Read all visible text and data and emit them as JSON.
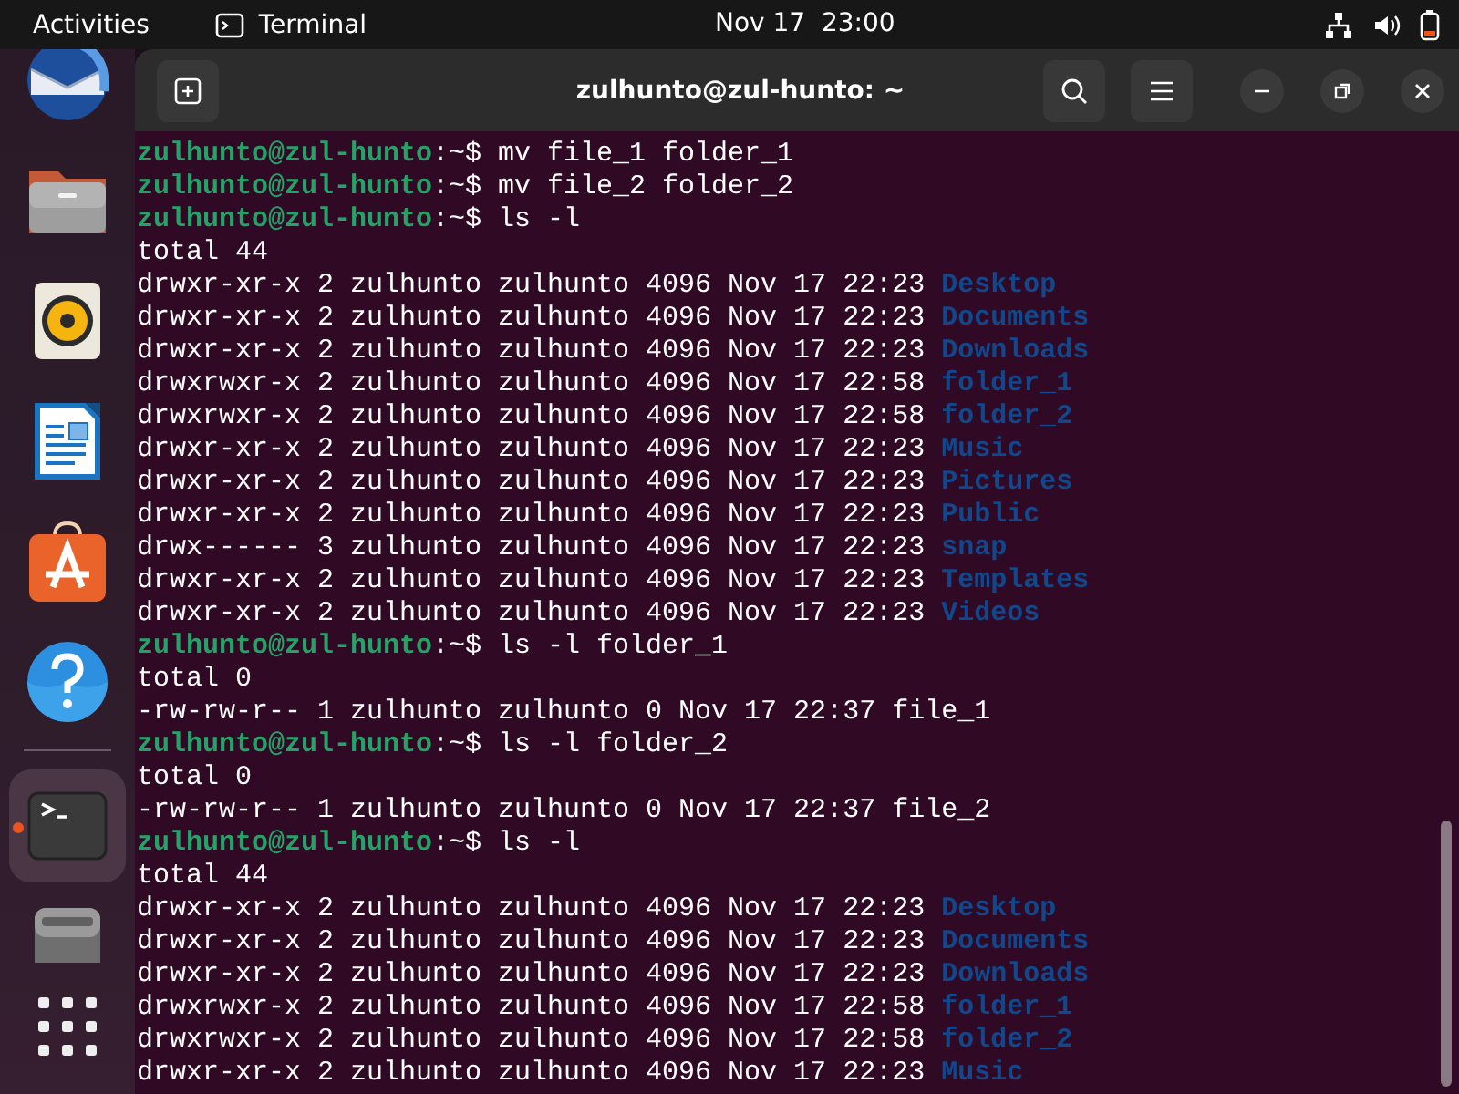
{
  "top_bar": {
    "activities": "Activities",
    "app_name": "Terminal",
    "clock": "Nov 17  23:00"
  },
  "dock": [
    {
      "kind": "mail",
      "focused": false,
      "running": false
    },
    {
      "kind": "files",
      "focused": false,
      "running": false
    },
    {
      "kind": "music",
      "focused": false,
      "running": false
    },
    {
      "kind": "writer",
      "focused": false,
      "running": false
    },
    {
      "kind": "store",
      "focused": false,
      "running": false
    },
    {
      "kind": "help",
      "focused": false,
      "running": false
    },
    {
      "kind": "separator"
    },
    {
      "kind": "terminal",
      "focused": true,
      "running": true
    },
    {
      "kind": "disk",
      "focused": false,
      "running": false
    },
    {
      "kind": "apps"
    }
  ],
  "window": {
    "title": "zulhunto@zul-hunto: ~"
  },
  "terminal": {
    "lines": [
      {
        "kind": "prompt",
        "user": "zulhunto@zul-hunto",
        "rest": ":~$ mv file_1 folder_1"
      },
      {
        "kind": "prompt",
        "user": "zulhunto@zul-hunto",
        "rest": ":~$ mv file_2 folder_2"
      },
      {
        "kind": "prompt",
        "user": "zulhunto@zul-hunto",
        "rest": ":~$ ls -l"
      },
      {
        "kind": "output",
        "text": "total 44"
      },
      {
        "kind": "entry",
        "info": "drwxr-xr-x 2 zulhunto zulhunto 4096 Nov 17 22:23",
        "name": "Desktop",
        "directory": true
      },
      {
        "kind": "entry",
        "info": "drwxr-xr-x 2 zulhunto zulhunto 4096 Nov 17 22:23",
        "name": "Documents",
        "directory": true
      },
      {
        "kind": "entry",
        "info": "drwxr-xr-x 2 zulhunto zulhunto 4096 Nov 17 22:23",
        "name": "Downloads",
        "directory": true
      },
      {
        "kind": "entry",
        "info": "drwxrwxr-x 2 zulhunto zulhunto 4096 Nov 17 22:58",
        "name": "folder_1",
        "directory": true
      },
      {
        "kind": "entry",
        "info": "drwxrwxr-x 2 zulhunto zulhunto 4096 Nov 17 22:58",
        "name": "folder_2",
        "directory": true
      },
      {
        "kind": "entry",
        "info": "drwxr-xr-x 2 zulhunto zulhunto 4096 Nov 17 22:23",
        "name": "Music",
        "directory": true
      },
      {
        "kind": "entry",
        "info": "drwxr-xr-x 2 zulhunto zulhunto 4096 Nov 17 22:23",
        "name": "Pictures",
        "directory": true
      },
      {
        "kind": "entry",
        "info": "drwxr-xr-x 2 zulhunto zulhunto 4096 Nov 17 22:23",
        "name": "Public",
        "directory": true
      },
      {
        "kind": "entry",
        "info": "drwx------ 3 zulhunto zulhunto 4096 Nov 17 22:23",
        "name": "snap",
        "directory": true
      },
      {
        "kind": "entry",
        "info": "drwxr-xr-x 2 zulhunto zulhunto 4096 Nov 17 22:23",
        "name": "Templates",
        "directory": true
      },
      {
        "kind": "entry",
        "info": "drwxr-xr-x 2 zulhunto zulhunto 4096 Nov 17 22:23",
        "name": "Videos",
        "directory": true
      },
      {
        "kind": "prompt",
        "user": "zulhunto@zul-hunto",
        "rest": ":~$ ls -l folder_1"
      },
      {
        "kind": "output",
        "text": "total 0"
      },
      {
        "kind": "entry",
        "info": "-rw-rw-r-- 1 zulhunto zulhunto 0 Nov 17 22:37",
        "name": "file_1",
        "directory": false
      },
      {
        "kind": "prompt",
        "user": "zulhunto@zul-hunto",
        "rest": ":~$ ls -l folder_2"
      },
      {
        "kind": "output",
        "text": "total 0"
      },
      {
        "kind": "entry",
        "info": "-rw-rw-r-- 1 zulhunto zulhunto 0 Nov 17 22:37",
        "name": "file_2",
        "directory": false
      },
      {
        "kind": "prompt",
        "user": "zulhunto@zul-hunto",
        "rest": ":~$ ls -l"
      },
      {
        "kind": "output",
        "text": "total 44"
      },
      {
        "kind": "entry",
        "info": "drwxr-xr-x 2 zulhunto zulhunto 4096 Nov 17 22:23",
        "name": "Desktop",
        "directory": true
      },
      {
        "kind": "entry",
        "info": "drwxr-xr-x 2 zulhunto zulhunto 4096 Nov 17 22:23",
        "name": "Documents",
        "directory": true
      },
      {
        "kind": "entry",
        "info": "drwxr-xr-x 2 zulhunto zulhunto 4096 Nov 17 22:23",
        "name": "Downloads",
        "directory": true
      },
      {
        "kind": "entry",
        "info": "drwxrwxr-x 2 zulhunto zulhunto 4096 Nov 17 22:58",
        "name": "folder_1",
        "directory": true
      },
      {
        "kind": "entry",
        "info": "drwxrwxr-x 2 zulhunto zulhunto 4096 Nov 17 22:58",
        "name": "folder_2",
        "directory": true
      },
      {
        "kind": "entry",
        "info": "drwxr-xr-x 2 zulhunto zulhunto 4096 Nov 17 22:23",
        "name": "Music",
        "directory": true
      }
    ]
  }
}
